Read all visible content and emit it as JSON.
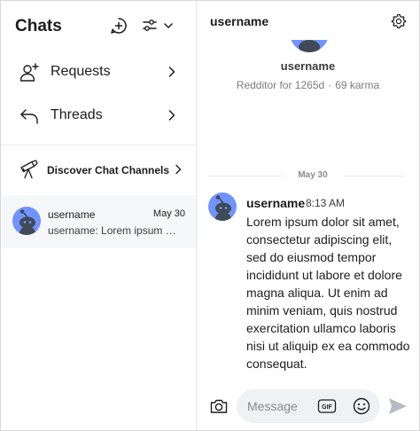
{
  "sidebar": {
    "title": "Chats",
    "nav": [
      {
        "label": "Requests",
        "icon": "add-person-icon"
      },
      {
        "label": "Threads",
        "icon": "reply-icon"
      }
    ],
    "discover": {
      "label": "Discover Chat Channels",
      "icon": "telescope-icon"
    },
    "chats": [
      {
        "name": "username",
        "date": "May 30",
        "preview": "username: Lorem ipsum dolor sit amet, consectetur adipiscing elit"
      }
    ]
  },
  "main": {
    "title": "username",
    "profile": {
      "name": "username",
      "age": "Redditor for 1265d",
      "separator": "·",
      "karma": "69 karma"
    },
    "date_separator": "May 30",
    "message": {
      "author": "username",
      "time": "8:13 AM",
      "text": "Lorem ipsum dolor sit amet, consectetur adipiscing elit, sed do eiusmod tempor incididunt ut labore et dolore magna aliqua. Ut enim ad minim veniam, quis nostrud exercitation ullamco laboris nisi ut aliquip ex ea commodo consequat."
    },
    "composer": {
      "placeholder": "Message",
      "gif_label": "GIF"
    }
  },
  "colors": {
    "avatar": "#7193ff",
    "selected_row": "#f6f7f8",
    "input_bg": "#eff1f3",
    "send": "#b8bcc2"
  }
}
